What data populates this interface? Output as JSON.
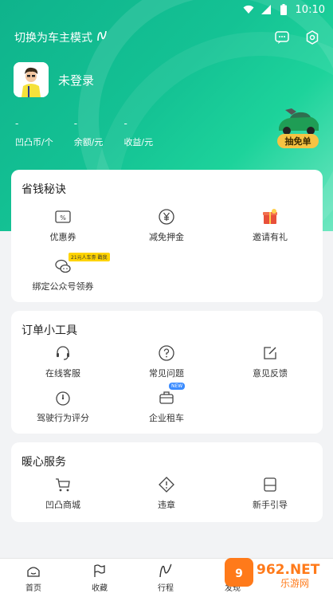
{
  "status_bar": {
    "time": "10:10"
  },
  "header": {
    "mode_switch_label": "切换为车主模式",
    "login_text": "未登录",
    "stats": [
      {
        "value": "-",
        "label": "凹凸币/个"
      },
      {
        "value": "-",
        "label": "余额/元"
      },
      {
        "value": "-",
        "label": "收益/元"
      }
    ],
    "badge_label": "抽免单"
  },
  "sections": {
    "savings": {
      "title": "省钱秘诀",
      "items": [
        {
          "label": "优惠券",
          "icon": "coupon-icon"
        },
        {
          "label": "减免押金",
          "icon": "yen-icon"
        },
        {
          "label": "邀请有礼",
          "icon": "gift-icon"
        },
        {
          "label": "绑定公众号领券",
          "icon": "wechat-icon",
          "tag": "21元人车劵 戳我"
        }
      ]
    },
    "tools": {
      "title": "订单小工具",
      "items": [
        {
          "label": "在线客服",
          "icon": "headset-icon"
        },
        {
          "label": "常见问题",
          "icon": "question-icon"
        },
        {
          "label": "意见反馈",
          "icon": "edit-icon"
        },
        {
          "label": "驾驶行为评分",
          "icon": "gauge-icon"
        },
        {
          "label": "企业租车",
          "icon": "briefcase-icon",
          "tag": "NEW"
        }
      ]
    },
    "services": {
      "title": "暖心服务",
      "items": [
        {
          "label": "凹凸商城",
          "icon": "cart-icon"
        },
        {
          "label": "违章",
          "icon": "warning-icon"
        },
        {
          "label": "新手引导",
          "icon": "guide-icon"
        }
      ]
    }
  },
  "tabbar": [
    {
      "label": "首页",
      "icon": "home-icon"
    },
    {
      "label": "收藏",
      "icon": "flag-icon"
    },
    {
      "label": "行程",
      "icon": "route-icon"
    },
    {
      "label": "发现",
      "icon": "discover-icon"
    }
  ],
  "watermark": {
    "text": "962.NET",
    "subtext": "乐游网"
  },
  "colors": {
    "brand": "#14c294",
    "badge": "#f6c343"
  }
}
